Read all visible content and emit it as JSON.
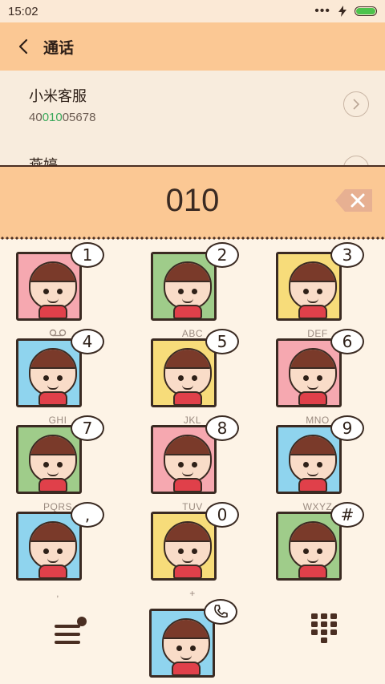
{
  "status_bar": {
    "time": "15:02",
    "icons": [
      "more-dots-icon",
      "charging-icon",
      "battery-icon"
    ]
  },
  "header": {
    "title": "通话",
    "back_icon": "back-arrow-icon"
  },
  "results": [
    {
      "name": "小米客服",
      "number_prefix": "40",
      "number_match": "010",
      "number_suffix": "05678"
    },
    {
      "name": "燕婷"
    }
  ],
  "input": {
    "digits": "010",
    "delete_icon": "backspace-icon"
  },
  "keypad": {
    "keys": [
      {
        "digit": "1",
        "letters": "",
        "sub_icon": "voicemail-icon",
        "color": "#f6a8b0"
      },
      {
        "digit": "2",
        "letters": "ABC",
        "color": "#9fcc8a"
      },
      {
        "digit": "3",
        "letters": "DEF",
        "color": "#f7dc7a"
      },
      {
        "digit": "4",
        "letters": "GHI",
        "color": "#8fd4ee"
      },
      {
        "digit": "5",
        "letters": "JKL",
        "color": "#f7dc7a"
      },
      {
        "digit": "6",
        "letters": "MNO",
        "color": "#f6a8b0"
      },
      {
        "digit": "7",
        "letters": "PQRS",
        "color": "#9fcc8a"
      },
      {
        "digit": "8",
        "letters": "TUV",
        "color": "#f6a8b0"
      },
      {
        "digit": "9",
        "letters": "WXYZ",
        "color": "#8fd4ee"
      },
      {
        "digit": ",",
        "letters": ",",
        "color": "#8fd4ee"
      },
      {
        "digit": "0",
        "letters": "+",
        "color": "#f7dc7a"
      },
      {
        "digit": "#",
        "letters": "",
        "color": "#9fcc8a"
      }
    ]
  },
  "bottom": {
    "menu_icon": "menu-icon",
    "call_icon": "phone-icon",
    "dialpad_icon": "dialpad-icon",
    "call_color": "#8fd4ee"
  }
}
